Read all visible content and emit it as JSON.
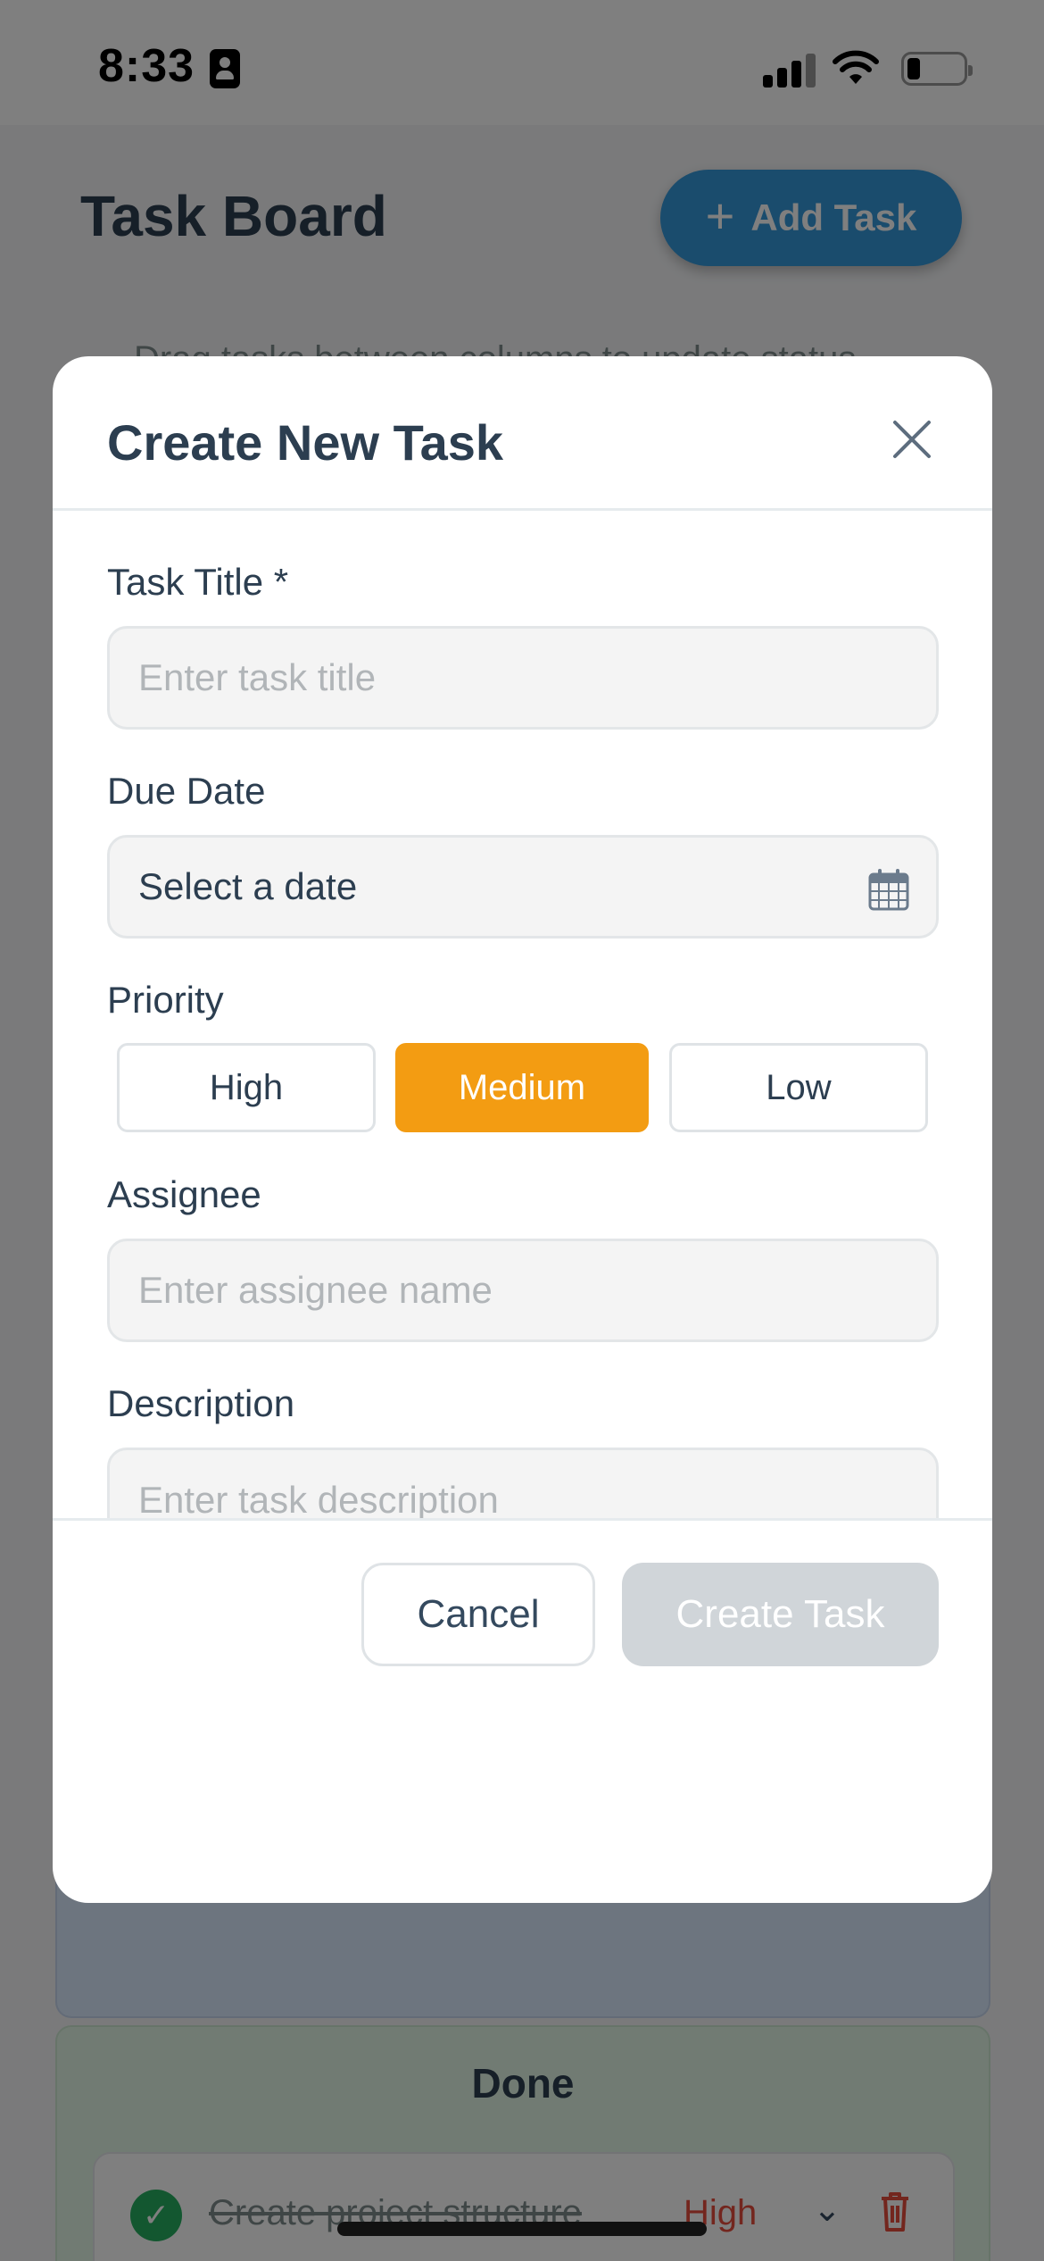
{
  "status_bar": {
    "time": "8:33"
  },
  "background": {
    "title": "Task Board",
    "add_button_label": "Add Task",
    "hint_text": "Drag tasks between columns to update status",
    "done_column": {
      "title": "Done",
      "task": {
        "name": "Create project structure",
        "priority": "High"
      }
    }
  },
  "modal": {
    "title": "Create New Task",
    "fields": {
      "title": {
        "label": "Task Title *",
        "placeholder": "Enter task title"
      },
      "due_date": {
        "label": "Due Date",
        "value": "Select a date"
      },
      "priority": {
        "label": "Priority",
        "options": [
          "High",
          "Medium",
          "Low"
        ],
        "selected": "Medium"
      },
      "assignee": {
        "label": "Assignee",
        "placeholder": "Enter assignee name"
      },
      "description": {
        "label": "Description",
        "placeholder": "Enter task description"
      }
    },
    "buttons": {
      "cancel": "Cancel",
      "create": "Create Task"
    }
  },
  "colors": {
    "accent_blue": "#3498db",
    "priority_selected": "#f39c12",
    "create_disabled": "#d0d5d9",
    "done_check": "#27ae60",
    "high_priority_text": "#e74c3c"
  }
}
